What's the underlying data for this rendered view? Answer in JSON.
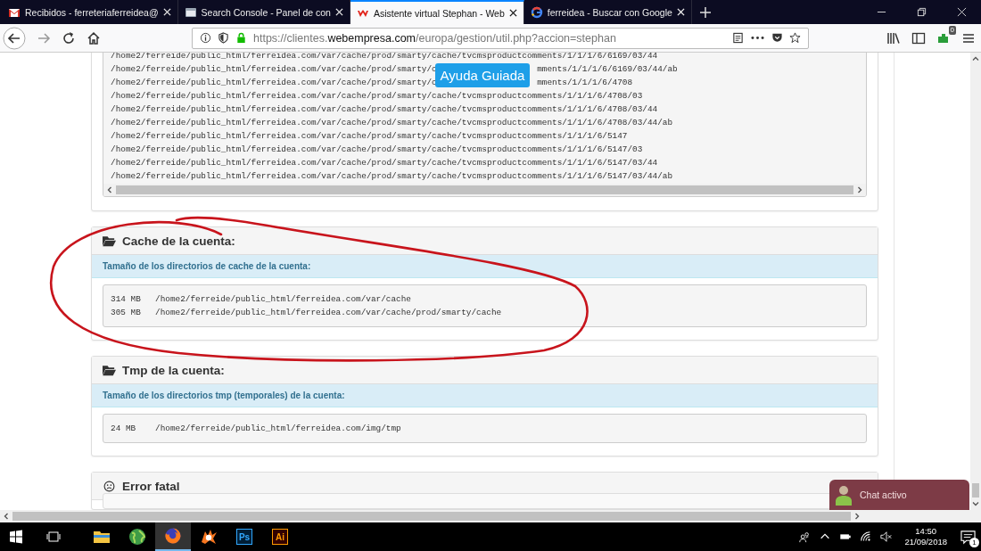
{
  "tabs": [
    {
      "kind": "mail",
      "label": "Recibidos - ferreteriaferreidea@",
      "selected": false
    },
    {
      "kind": "console",
      "label": "Search Console - Panel de con",
      "selected": false
    },
    {
      "kind": "webempresa",
      "label": "Asistente virtual Stephan - Web",
      "selected": true
    },
    {
      "kind": "google",
      "label": "ferreidea - Buscar con Google",
      "selected": false
    }
  ],
  "address_bar": {
    "prefix": "https://clientes.",
    "domain": "webempresa.com",
    "path": "/europa/gestion/util.php?accion=stephan"
  },
  "extension_badge": "0",
  "guide_button": "Ayuda Guiada",
  "listing": [
    {
      "text": "/home2/ferreide/public_html/ferreidea.com/var/cache/prod/smarty/cache/tvcmsproductcomments/1/1/1/6/6169/03/44"
    },
    {
      "text": "/home2/ferreide/public_html/ferreidea.com/var/cache/prod/smarty/c",
      "text_after": "mments/1/1/1/6/6169/03/44/ab"
    },
    {
      "text": "/home2/ferreide/public_html/ferreidea.com/var/cache/prod/smarty/c",
      "text_after": "mments/1/1/1/6/4708"
    },
    {
      "text": "/home2/ferreide/public_html/ferreidea.com/var/cache/prod/smarty/cache/tvcmsproductcomments/1/1/1/6/4708/03"
    },
    {
      "text": "/home2/ferreide/public_html/ferreidea.com/var/cache/prod/smarty/cache/tvcmsproductcomments/1/1/1/6/4708/03/44"
    },
    {
      "text": "/home2/ferreide/public_html/ferreidea.com/var/cache/prod/smarty/cache/tvcmsproductcomments/1/1/1/6/4708/03/44/ab"
    },
    {
      "text": "/home2/ferreide/public_html/ferreidea.com/var/cache/prod/smarty/cache/tvcmsproductcomments/1/1/1/6/5147"
    },
    {
      "text": "/home2/ferreide/public_html/ferreidea.com/var/cache/prod/smarty/cache/tvcmsproductcomments/1/1/1/6/5147/03"
    },
    {
      "text": "/home2/ferreide/public_html/ferreidea.com/var/cache/prod/smarty/cache/tvcmsproductcomments/1/1/1/6/5147/03/44"
    },
    {
      "text": "/home2/ferreide/public_html/ferreidea.com/var/cache/prod/smarty/cache/tvcmsproductcomments/1/1/1/6/5147/03/44/ab"
    }
  ],
  "panels": [
    {
      "kind": "folder",
      "title": "Cache de la cuenta:",
      "info": "Tamaño de los directorios de cache de la cuenta:",
      "rows": [
        {
          "size": "314 MB",
          "path": "/home2/ferreide/public_html/ferreidea.com/var/cache"
        },
        {
          "size": "305 MB",
          "path": "/home2/ferreide/public_html/ferreidea.com/var/cache/prod/smarty/cache"
        }
      ]
    },
    {
      "kind": "folder",
      "title": "Tmp de la cuenta:",
      "info": "Tamaño de los directorios tmp (temporales) de la cuenta:",
      "rows": [
        {
          "size": "24 MB",
          "path": "/home2/ferreide/public_html/ferreidea.com/img/tmp"
        }
      ]
    },
    {
      "kind": "error",
      "title": "Error fatal"
    }
  ],
  "chat_widget": "Chat activo",
  "taskbar": {
    "apps": [
      {
        "kind": "explorer",
        "selected": false
      },
      {
        "kind": "globe",
        "selected": false
      },
      {
        "kind": "firefox",
        "selected": true
      },
      {
        "kind": "avast",
        "selected": false
      },
      {
        "kind": "ps",
        "label": "Ps",
        "selected": false
      },
      {
        "kind": "ai",
        "label": "Ai",
        "selected": false
      }
    ],
    "time": "14:50",
    "date": "21/09/2018",
    "notifications": "1"
  }
}
